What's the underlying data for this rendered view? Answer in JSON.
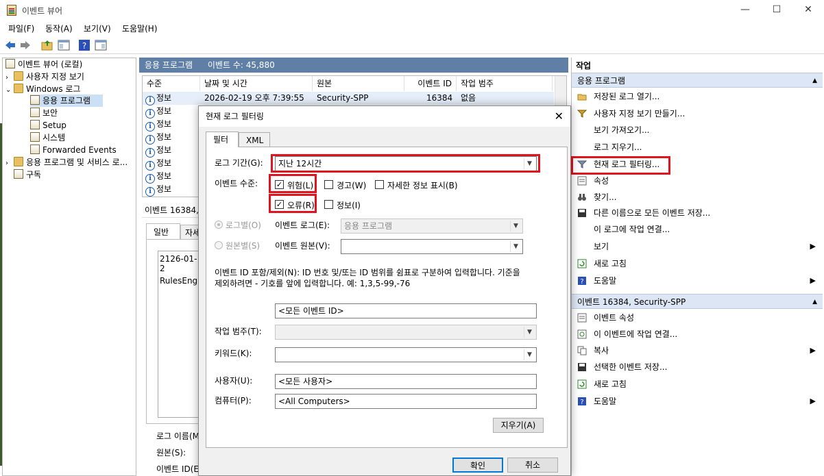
{
  "window": {
    "title": "이벤트 뷰어"
  },
  "menu": [
    "파일(F)",
    "동작(A)",
    "보기(V)",
    "도움말(H)"
  ],
  "tree": {
    "root": "이벤트 뷰어 (로컬)",
    "custom_views": "사용자 지정 보기",
    "windows_logs": "Windows 로그",
    "application": "응용 프로그램",
    "security": "보안",
    "setup": "Setup",
    "system": "시스템",
    "forwarded": "Forwarded Events",
    "app_services": "응용 프로그램 및 서비스 로...",
    "subscriptions": "구독"
  },
  "center": {
    "header_name": "응용 프로그램",
    "header_count": "이벤트 수: 45,880",
    "columns": [
      "수준",
      "날짜 및 시간",
      "원본",
      "이벤트 ID",
      "작업 범주"
    ],
    "first_row": {
      "level": "정보",
      "date": "2026-02-19 오후 7:39:55",
      "source": "Security-SPP",
      "id": "16384",
      "category": "없음"
    },
    "other_levels": [
      "정보",
      "정보",
      "정보",
      "정보",
      "정보",
      "정보",
      "정보"
    ],
    "detail_header": "이벤트 16384,",
    "detail_tabs": [
      "일반",
      "자세"
    ],
    "detail_text1": "2126-01-2",
    "detail_text2": "RulesEngin",
    "detail_labels": [
      "로그 이름(M",
      "원본(S):",
      "이벤트 ID(E"
    ]
  },
  "actions": {
    "header": "작업",
    "section1": "응용 프로그램",
    "items1": [
      "저장된 로그 열기...",
      "사용자 지정 보기 만들기...",
      "보기 가져오기...",
      "로그 지우기...",
      "현재 로그 필터링...",
      "속성",
      "찾기...",
      "다른 이름으로 모든 이벤트 저장...",
      "이 로그에 작업 연결...",
      "보기",
      "새로 고침",
      "도움말"
    ],
    "section2": "이벤트 16384, Security-SPP",
    "items2": [
      "이벤트 속성",
      "이 이벤트에 작업 연결...",
      "복사",
      "선택한 이벤트 저장...",
      "새로 고침",
      "도움말"
    ]
  },
  "dialog": {
    "title": "현재 로그 필터링",
    "tabs": [
      "필터",
      "XML"
    ],
    "logged_label": "로그 기간(G):",
    "logged_value": "지난 12시간",
    "level_label": "이벤트 수준:",
    "critical": "위험(L)",
    "warning": "경고(W)",
    "verbose": "자세한 정보 표시(B)",
    "error": "오류(R)",
    "information": "정보(I)",
    "by_log": "로그별(O)",
    "by_source": "원본별(S)",
    "event_logs_label": "이벤트 로그(E):",
    "event_logs_value": "응용 프로그램",
    "event_sources_label": "이벤트 원본(V):",
    "event_sources_value": "",
    "id_desc1": "이벤트 ID 포함/제외(N): ID 번호 및/또는 ID 범위를 쉼표로 구분하여 입력합니다. 기준을",
    "id_desc2": "제외하려면 - 기호를 앞에 입력합니다. 예: 1,3,5-99,-76",
    "id_value": "<모든 이벤트 ID>",
    "task_label": "작업 범주(T):",
    "keywords_label": "키워드(K):",
    "user_label": "사용자(U):",
    "user_value": "<모든 사용자>",
    "computer_label": "컴퓨터(P):",
    "computer_value": "<All Computers>",
    "clear_btn": "지우기(A)",
    "ok_btn": "확인",
    "cancel_btn": "취소"
  }
}
